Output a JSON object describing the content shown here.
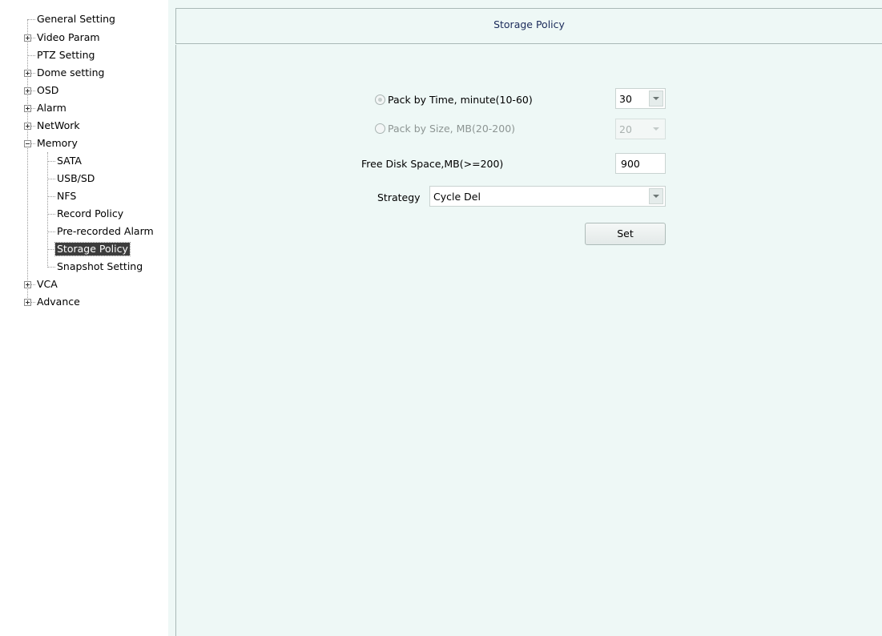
{
  "sidebar": {
    "items": [
      {
        "label": "General Setting"
      },
      {
        "label": "Video Param"
      },
      {
        "label": "PTZ Setting"
      },
      {
        "label": "Dome setting"
      },
      {
        "label": "OSD"
      },
      {
        "label": "Alarm"
      },
      {
        "label": "NetWork"
      },
      {
        "label": "Memory"
      },
      {
        "label": "SATA"
      },
      {
        "label": "USB/SD"
      },
      {
        "label": "NFS"
      },
      {
        "label": "Record Policy"
      },
      {
        "label": "Pre-recorded Alarm"
      },
      {
        "label": "Storage Policy"
      },
      {
        "label": "Snapshot Setting"
      },
      {
        "label": "VCA"
      },
      {
        "label": "Advance"
      }
    ],
    "selected": "Storage Policy"
  },
  "page": {
    "title": "Storage Policy"
  },
  "form": {
    "pack_by_time_label": "Pack by Time, minute(10-60)",
    "pack_by_time_value": "30",
    "pack_by_size_label": "Pack by Size, MB(20-200)",
    "pack_by_size_value": "20",
    "free_disk_label": "Free Disk Space,MB(>=200)",
    "free_disk_value": "900",
    "strategy_label": "Strategy",
    "strategy_value": "Cycle Del",
    "set_button": "Set"
  }
}
